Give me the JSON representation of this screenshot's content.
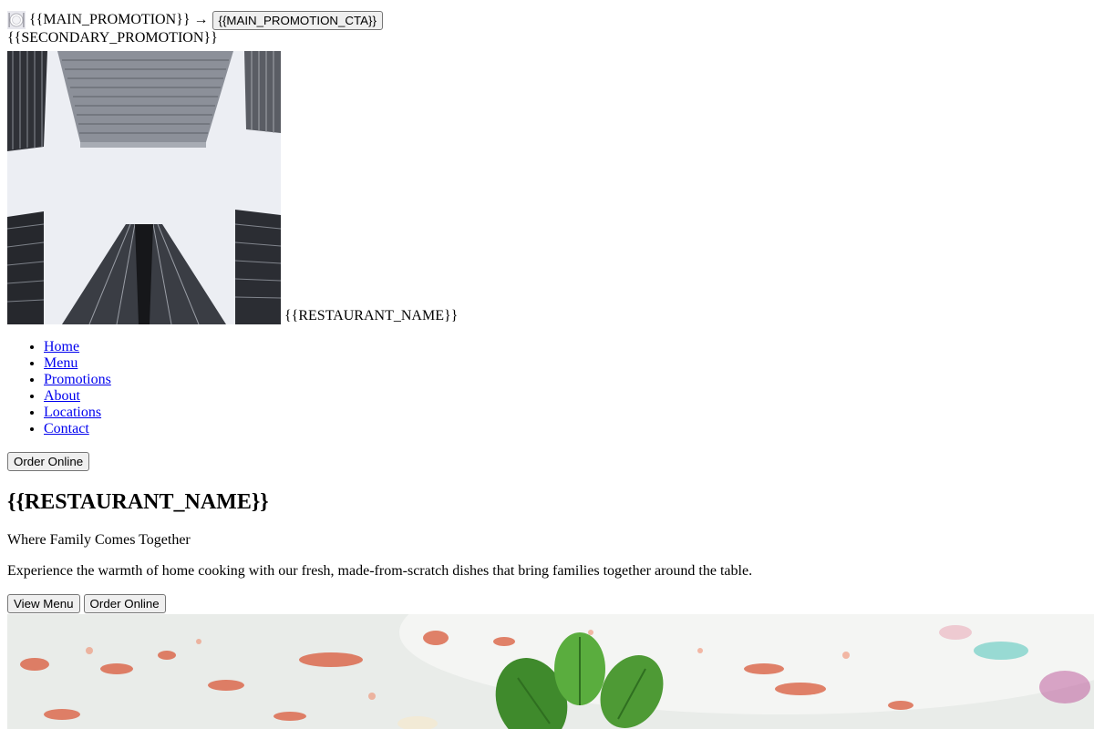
{
  "promo_bar": {
    "main_promotion": "{{MAIN_PROMOTION}}",
    "arrow": "→",
    "cta_label": "{{MAIN_PROMOTION_CTA}}",
    "secondary_promotion": "{{SECONDARY_PROMOTION}}",
    "icon": "plate-cutlery-icon"
  },
  "header": {
    "logo_icon": "building-photo-logo",
    "restaurant_name": "{{RESTAURANT_NAME}}"
  },
  "nav": {
    "items": [
      {
        "label": "Home"
      },
      {
        "label": "Menu"
      },
      {
        "label": "Promotions"
      },
      {
        "label": "About"
      },
      {
        "label": "Locations"
      },
      {
        "label": "Contact"
      }
    ],
    "order_button": "Order Online"
  },
  "hero": {
    "title": "{{RESTAURANT_NAME}}",
    "tagline": "Where Family Comes Together",
    "description": "Experience the warmth of home cooking with our fresh, made-from-scratch dishes that bring families together around the table.",
    "view_menu_button": "View Menu",
    "order_button": "Order Online",
    "image_icon": "pasta-dish-photo"
  }
}
